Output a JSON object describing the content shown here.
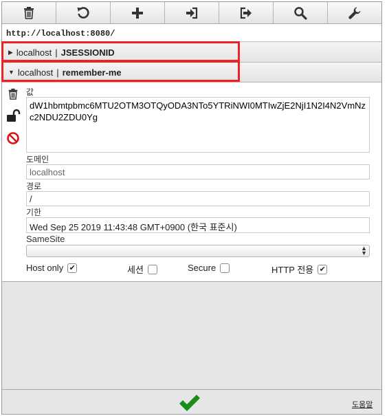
{
  "toolbar": {
    "buttons": [
      {
        "name": "delete-all-button",
        "icon": "trash-icon"
      },
      {
        "name": "reset-button",
        "icon": "undo-icon"
      },
      {
        "name": "add-button",
        "icon": "plus-icon"
      },
      {
        "name": "import-button",
        "icon": "import-icon"
      },
      {
        "name": "export-button",
        "icon": "export-icon"
      },
      {
        "name": "search-button",
        "icon": "search-icon"
      },
      {
        "name": "options-button",
        "icon": "wrench-icon"
      }
    ]
  },
  "url": "http://localhost:8080/",
  "cookies": [
    {
      "domain": "localhost",
      "separator": "|",
      "name": "JSESSIONID",
      "expanded": false
    },
    {
      "domain": "localhost",
      "separator": "|",
      "name": "remember-me",
      "expanded": true
    }
  ],
  "details": {
    "value_label": "값",
    "value": "dW1hbmtpbmc6MTU2OTM3OTQyODA3NTo5YTRiNWI0MTIwZjE2NjI1N2I4N2VmNzc2NDU2ZDU0Yg",
    "domain_label": "도메인",
    "domain": "localhost",
    "path_label": "경로",
    "path": "/",
    "expires_label": "기한",
    "expires": "Wed Sep 25 2019 11:43:48 GMT+0900 (한국 표준시)",
    "samesite_label": "SameSite",
    "samesite": "",
    "host_only_label": "Host only",
    "host_only": true,
    "session_label": "세션",
    "session": false,
    "secure_label": "Secure",
    "secure": false,
    "http_only_label": "HTTP 전용",
    "http_only": true
  },
  "footer": {
    "help_label": "도움말"
  },
  "colors": {
    "highlight": "#ee2222",
    "ok": "#1a8c1a",
    "block": "#dd1111"
  }
}
